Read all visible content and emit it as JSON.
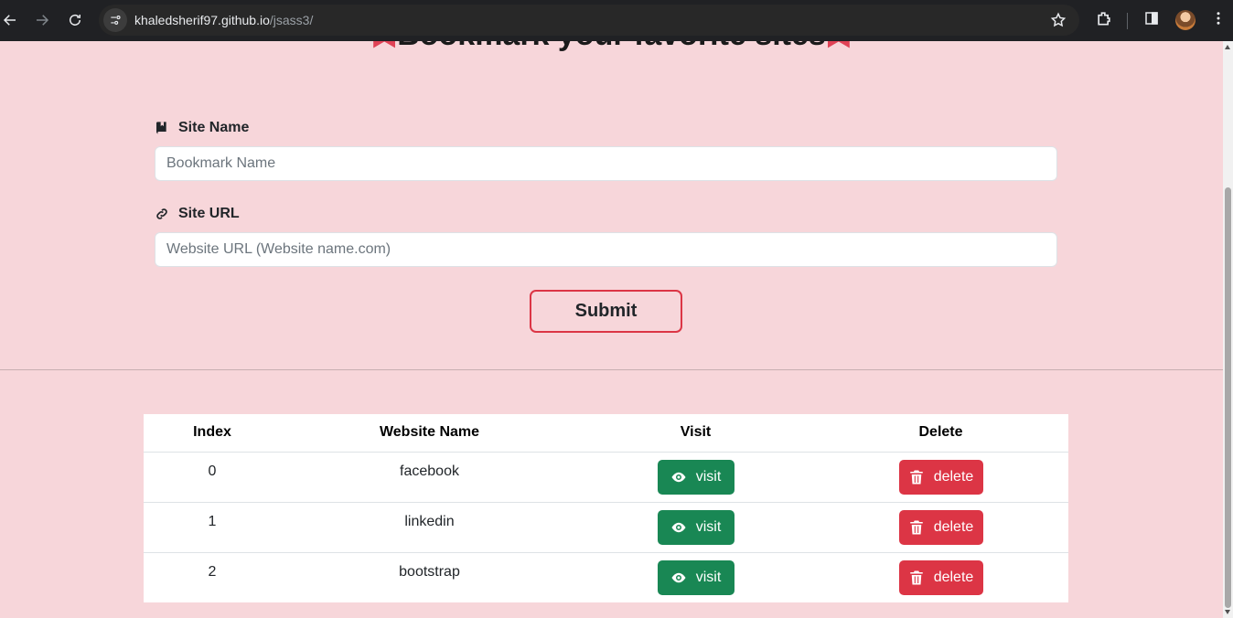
{
  "browser": {
    "url_host": "khaledsherif97.github.io",
    "url_path": "/jsass3/"
  },
  "page": {
    "heading": "Bookmark your favorite sites"
  },
  "form": {
    "site_name_label": "Site Name",
    "site_name_placeholder": "Bookmark Name",
    "site_url_label": "Site URL",
    "site_url_placeholder": "Website URL (Website name.com)",
    "submit_label": "Submit"
  },
  "table": {
    "headers": [
      "Index",
      "Website Name",
      "Visit",
      "Delete"
    ],
    "rows": [
      {
        "index": "0",
        "name": "facebook",
        "visit": "visit",
        "delete": "delete"
      },
      {
        "index": "1",
        "name": "linkedin",
        "visit": "visit",
        "delete": "delete"
      },
      {
        "index": "2",
        "name": "bootstrap",
        "visit": "visit",
        "delete": "delete"
      }
    ]
  },
  "colors": {
    "page_background": "#f7d6da",
    "visit_button": "#198754",
    "delete_button": "#dc3545",
    "submit_border": "#dc3545"
  }
}
